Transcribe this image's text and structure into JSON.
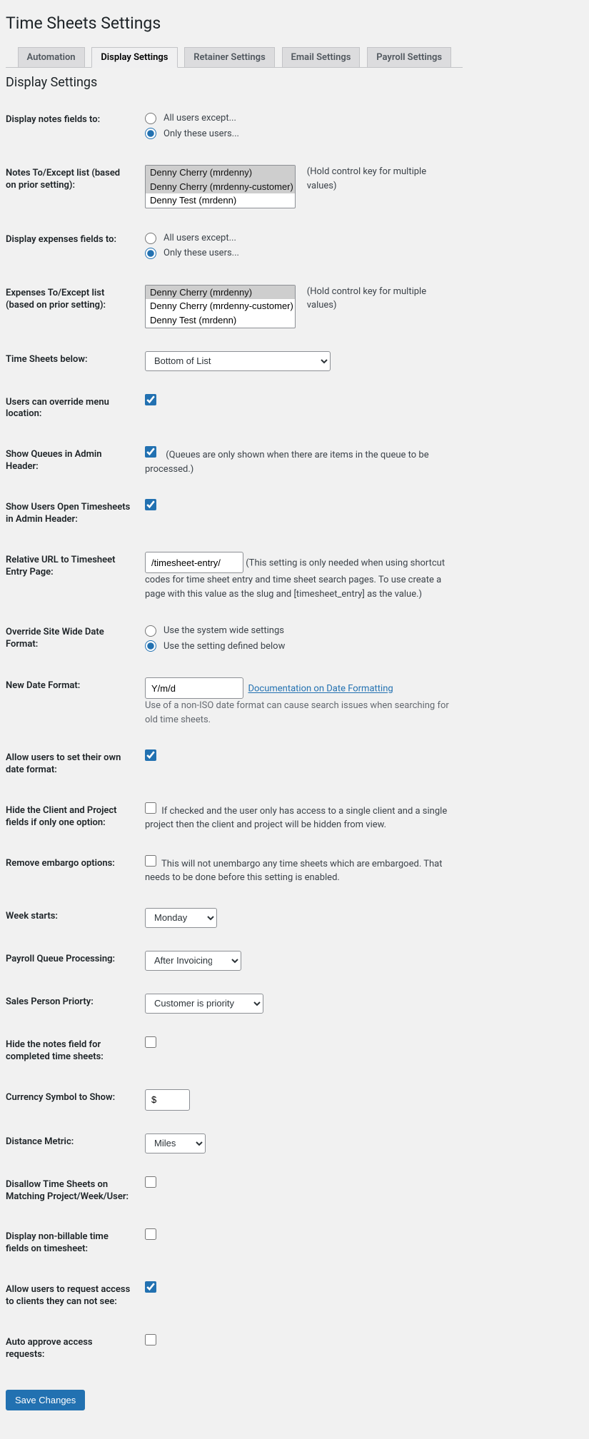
{
  "page_title": "Time Sheets Settings",
  "tabs": [
    "Automation",
    "Display Settings",
    "Retainer Settings",
    "Email Settings",
    "Payroll Settings"
  ],
  "active_tab": 1,
  "section_heading": "Display Settings",
  "rows": {
    "display_notes": {
      "label": "Display notes fields to:",
      "opt1": "All users except...",
      "opt2": "Only these users..."
    },
    "notes_list": {
      "label": "Notes To/Except list (based on prior setting):",
      "options": [
        "Denny Cherry (mrdenny)",
        "Denny Cherry (mrdenny-customer)",
        "Denny Test (mrdenn)"
      ],
      "hint": "(Hold control key for multiple values)"
    },
    "display_expenses": {
      "label": "Display expenses fields to:",
      "opt1": "All users except...",
      "opt2": "Only these users..."
    },
    "expenses_list": {
      "label": "Expenses To/Except list (based on prior setting):",
      "options": [
        "Denny Cherry (mrdenny)",
        "Denny Cherry (mrdenny-customer)",
        "Denny Test (mrdenn)"
      ],
      "hint": "(Hold control key for multiple values)"
    },
    "ts_below": {
      "label": "Time Sheets below:",
      "value": "Bottom of List"
    },
    "override_menu": {
      "label": "Users can override menu location:"
    },
    "show_queues": {
      "label": "Show Queues in Admin Header:",
      "hint": "(Queues are only shown when there are items in the queue to be processed.)"
    },
    "show_open": {
      "label": "Show Users Open Timesheets in Admin Header:"
    },
    "rel_url": {
      "label": "Relative URL to Timesheet Entry Page:",
      "value": "/timesheet-entry/",
      "hint": "(This setting is only needed when using shortcut codes for time sheet entry and time sheet search pages. To use create a page with this value as the slug and [timesheet_entry] as the value.)"
    },
    "override_date": {
      "label": "Override Site Wide Date Format:",
      "opt1": "Use the system wide settings",
      "opt2": "Use the setting defined below"
    },
    "new_date": {
      "label": "New Date Format:",
      "value": "Y/m/d",
      "link_text": "Documentation on Date Formatting",
      "hint": "Use of a non-ISO date format can cause search issues when searching for old time sheets."
    },
    "allow_own_date": {
      "label": "Allow users to set their own date format:"
    },
    "hide_client": {
      "label": "Hide the Client and Project fields if only one option:",
      "hint": "If checked and the user only has access to a single client and a single project then the client and project will be hidden from view."
    },
    "remove_embargo": {
      "label": "Remove embargo options:",
      "hint": "This will not unembargo any time sheets which are embargoed. That needs to be done before this setting is enabled."
    },
    "week_starts": {
      "label": "Week starts:",
      "value": "Monday"
    },
    "payroll_q": {
      "label": "Payroll Queue Processing:",
      "value": "After Invoicing"
    },
    "sales_priority": {
      "label": "Sales Person Priorty:",
      "value": "Customer is priority"
    },
    "hide_notes_completed": {
      "label": "Hide the notes field for completed time sheets:"
    },
    "currency": {
      "label": "Currency Symbol to Show:",
      "value": "$"
    },
    "distance": {
      "label": "Distance Metric:",
      "value": "Miles"
    },
    "disallow": {
      "label": "Disallow Time Sheets on Matching Project/Week/User:"
    },
    "nonbillable": {
      "label": "Display non-billable time fields on timesheet:"
    },
    "req_access": {
      "label": "Allow users to request access to clients they can not see:"
    },
    "auto_approve": {
      "label": "Auto approve access requests:"
    }
  },
  "save_button": "Save Changes"
}
